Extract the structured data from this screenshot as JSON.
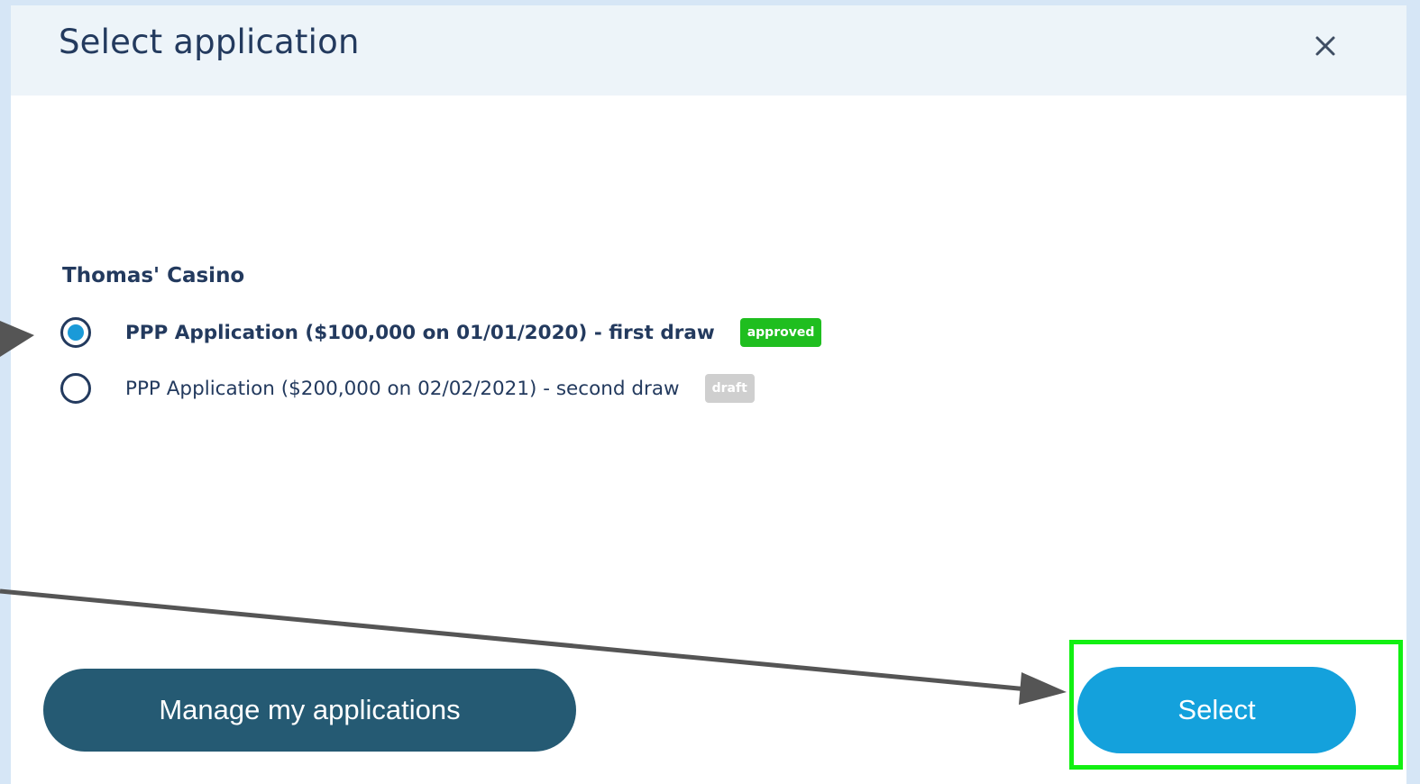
{
  "modal": {
    "title": "Select application",
    "close_icon": "close-icon"
  },
  "business": {
    "name": "Thomas' Casino"
  },
  "applications": [
    {
      "label": "PPP Application ($100,000 on 01/01/2020) - first draw",
      "status": "approved",
      "selected": true
    },
    {
      "label": "PPP Application ($200,000 on 02/02/2021) - second draw",
      "status": "draft",
      "selected": false
    }
  ],
  "buttons": {
    "manage_label": "Manage my applications",
    "select_label": "Select"
  },
  "colors": {
    "header_bg": "#edf4f9",
    "text_primary": "#233a5e",
    "radio_fill": "#1a9ad8",
    "approved_badge": "#1fbe1f",
    "draft_badge": "#cfcfcf",
    "manage_button": "#255a73",
    "select_button": "#14a1dc",
    "annotation_highlight": "#12f012",
    "annotation_arrow": "#555555"
  }
}
